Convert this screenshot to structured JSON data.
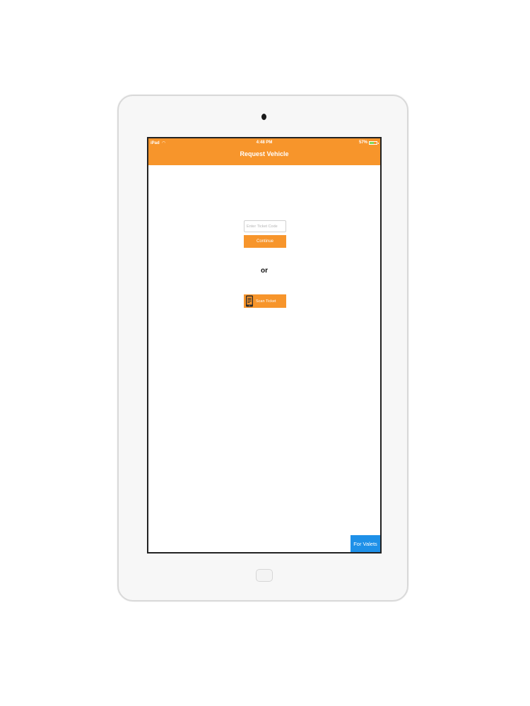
{
  "device": {
    "icons": {
      "camera": "camera-dot",
      "home": "home-button"
    }
  },
  "status_bar": {
    "carrier": "iPad",
    "time": "4:48 PM",
    "battery_percent": "57%",
    "battery_level": 0.57,
    "icons": {
      "wifi": "wifi-icon",
      "battery": "battery-icon"
    },
    "colors": {
      "battery_fill": "#7ed957"
    }
  },
  "nav_bar": {
    "title": "Request Vehicle"
  },
  "ticket_form": {
    "input_value": "",
    "input_placeholder": "Enter Ticket Code",
    "continue_label": "Continue"
  },
  "separator": {
    "or_label": "or"
  },
  "scan": {
    "label": "Scan Ticket",
    "icon": "phone-scan-icon"
  },
  "footer": {
    "valets_label": "For Valets"
  },
  "colors": {
    "accent": "#f7952b",
    "valets_blue": "#1e90e8",
    "screen_bg": "#ffffff",
    "device_body": "#f7f7f7"
  }
}
